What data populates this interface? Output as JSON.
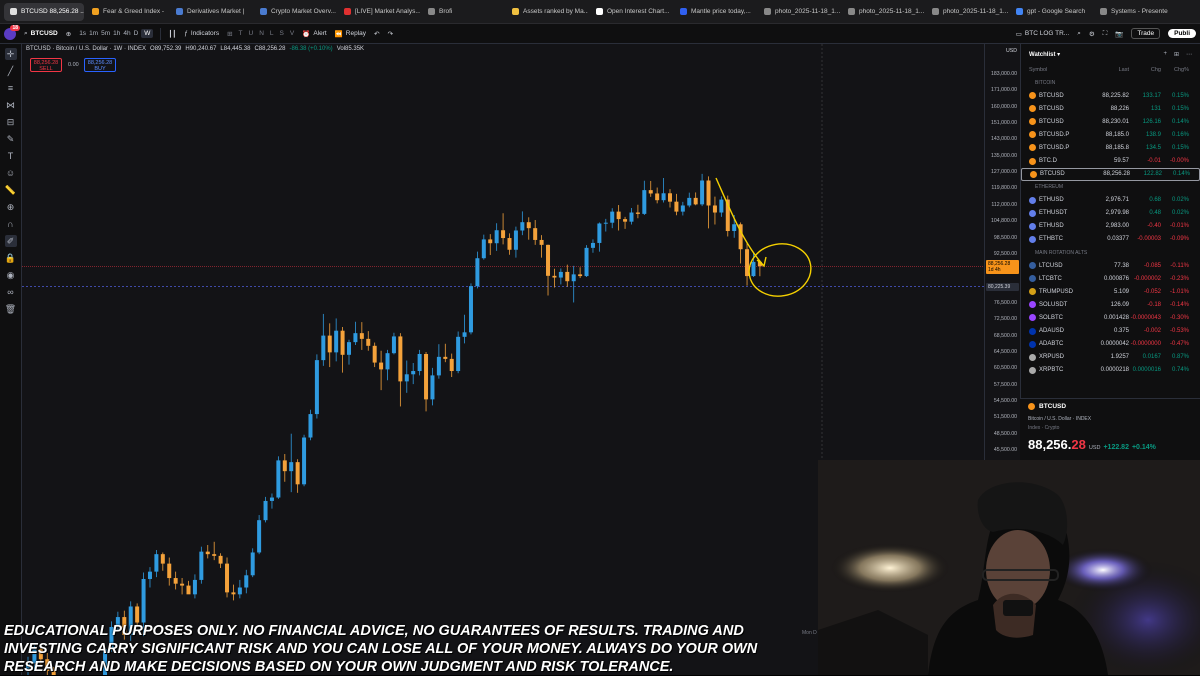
{
  "browser_tabs": [
    {
      "label": "BTCUSD 88,256.28 ...",
      "color": "#e0e0e0",
      "active": true
    },
    {
      "label": "Fear & Greed Index -",
      "color": "#f0a020"
    },
    {
      "label": "Derivatives Market |",
      "color": "#4a7bd0"
    },
    {
      "label": "Crypto Market Overv...",
      "color": "#4a7bd0"
    },
    {
      "label": "[LIVE] Market Analys...",
      "color": "#e03030"
    },
    {
      "label": "Brofi",
      "color": "#888888"
    },
    {
      "label": "Assets ranked by Ma...",
      "color": "#f0c040"
    },
    {
      "label": "Open Interest Chart...",
      "color": "#ffffff"
    },
    {
      "label": "Mantle price today,...",
      "color": "#3060f0"
    },
    {
      "label": "photo_2025-11-18_1...",
      "color": "#888888"
    },
    {
      "label": "photo_2025-11-18_1...",
      "color": "#888888"
    },
    {
      "label": "photo_2025-11-18_1...",
      "color": "#888888"
    },
    {
      "label": "gpt - Google Search",
      "color": "#4285f4"
    },
    {
      "label": "Systems - Presente",
      "color": "#888888"
    }
  ],
  "toolbar": {
    "badge": "18",
    "symbol": "BTCUSD",
    "timeframes": [
      "1s",
      "1m",
      "5m",
      "1h",
      "4h",
      "D",
      "W"
    ],
    "selected_timeframe": "W",
    "indicators": "Indicators",
    "alert": "Alert",
    "replay": "Replay",
    "layout_name": "BTC LOG TR...",
    "trade": "Trade",
    "publish": "Publi"
  },
  "legend": {
    "title": "BTCUSD · Bitcoin / U.S. Dollar · 1W · INDEX",
    "open": "O89,752.39",
    "high": "H90,240.67",
    "low": "L84,445.38",
    "close": "C88,256.28",
    "change": "-86.38 (+0.10%)",
    "volume": "Vol85.35K",
    "sell_price": "88,256.28",
    "sell_label": "SELL",
    "spread": "0.00",
    "buy_price": "88,256.28",
    "buy_label": "BUY"
  },
  "price_axis": {
    "currency": "USD",
    "ticks": [
      "183,000.00",
      "171,000.00",
      "160,000.00",
      "151,000.00",
      "143,000.00",
      "135,000.00",
      "127,000.00",
      "119,800.00",
      "112,000.00",
      "104,800.00",
      "98,500.00",
      "92,500.00",
      "86,900.00",
      "80,225.39",
      "76,500.00",
      "72,500.00",
      "68,500.00",
      "64,500.00",
      "60,500.00",
      "57,500.00",
      "54,500.00",
      "51,500.00",
      "48,500.00",
      "45,500.00"
    ],
    "current_price": "88,256.28",
    "current_time": "1d 4h",
    "line_price": "80,225.39"
  },
  "chart_data": {
    "type": "candlestick",
    "timeframe": "1W",
    "current_price": 88256.28,
    "horizontal_line": 80225.39,
    "candles": [
      [
        19400,
        20300,
        18500,
        19800
      ],
      [
        19800,
        21400,
        19200,
        20900
      ],
      [
        20900,
        21300,
        19700,
        20100
      ],
      [
        20100,
        20600,
        18800,
        19200
      ],
      [
        19200,
        19500,
        17500,
        17800
      ],
      [
        17800,
        18300,
        17200,
        17100
      ],
      [
        17100,
        17400,
        16300,
        16600
      ],
      [
        16600,
        17200,
        16100,
        16800
      ],
      [
        16800,
        17500,
        16500,
        17300
      ],
      [
        17300,
        17800,
        16800,
        17000
      ],
      [
        17000,
        17400,
        16700,
        16600
      ],
      [
        16600,
        17300,
        16400,
        17100
      ],
      [
        17100,
        21300,
        16900,
        20900
      ],
      [
        20900,
        23300,
        20700,
        22800
      ],
      [
        22800,
        24200,
        22500,
        23700
      ],
      [
        23700,
        24300,
        21700,
        22100
      ],
      [
        22100,
        25200,
        21600,
        24700
      ],
      [
        24700,
        25000,
        22700,
        23200
      ],
      [
        23200,
        28200,
        22000,
        27500
      ],
      [
        27500,
        28800,
        26600,
        28300
      ],
      [
        28300,
        30800,
        27700,
        30300
      ],
      [
        30300,
        30500,
        28400,
        29200
      ],
      [
        29200,
        29900,
        26800,
        27600
      ],
      [
        27600,
        28300,
        26400,
        27000
      ],
      [
        27000,
        27600,
        25900,
        26800
      ],
      [
        26800,
        27300,
        26300,
        25900
      ],
      [
        25900,
        28000,
        25500,
        27400
      ],
      [
        27400,
        31200,
        27000,
        30600
      ],
      [
        30600,
        31400,
        29800,
        30300
      ],
      [
        30300,
        31800,
        29600,
        30100
      ],
      [
        30100,
        30400,
        28700,
        29200
      ],
      [
        29200,
        29900,
        25600,
        26100
      ],
      [
        26100,
        26900,
        25300,
        25900
      ],
      [
        25900,
        27400,
        25500,
        26600
      ],
      [
        26600,
        28500,
        26000,
        27900
      ],
      [
        27900,
        31000,
        27700,
        30500
      ],
      [
        30500,
        35300,
        30300,
        34600
      ],
      [
        34600,
        37900,
        34300,
        37300
      ],
      [
        37300,
        38400,
        36200,
        37800
      ],
      [
        37800,
        44400,
        37600,
        43700
      ],
      [
        43700,
        44800,
        40200,
        41900
      ],
      [
        41900,
        48500,
        38600,
        43400
      ],
      [
        43400,
        43900,
        38500,
        39800
      ],
      [
        39800,
        48300,
        39500,
        47800
      ],
      [
        47800,
        52900,
        47300,
        52100
      ],
      [
        52100,
        63900,
        51300,
        62500
      ],
      [
        62500,
        73800,
        61100,
        68500
      ],
      [
        68500,
        71500,
        60800,
        64400
      ],
      [
        64400,
        72700,
        62200,
        69700
      ],
      [
        69700,
        70600,
        59700,
        63800
      ],
      [
        63800,
        67500,
        61400,
        66900
      ],
      [
        66900,
        71900,
        66200,
        69100
      ],
      [
        69100,
        71800,
        65000,
        67700
      ],
      [
        67700,
        69600,
        64800,
        66000
      ],
      [
        66000,
        66800,
        60800,
        61900
      ],
      [
        61900,
        64800,
        56500,
        60300
      ],
      [
        60300,
        65000,
        58300,
        64200
      ],
      [
        64200,
        69200,
        63900,
        68300
      ],
      [
        68300,
        69100,
        53500,
        58100
      ],
      [
        58100,
        62400,
        56000,
        59400
      ],
      [
        59400,
        61800,
        57600,
        60000
      ],
      [
        60000,
        65000,
        59200,
        64000
      ],
      [
        64000,
        64500,
        52600,
        54800
      ],
      [
        54800,
        60600,
        53700,
        59200
      ],
      [
        59200,
        66400,
        58600,
        63300
      ],
      [
        63300,
        66500,
        62000,
        62800
      ],
      [
        62800,
        64100,
        58900,
        60000
      ],
      [
        60000,
        69500,
        59600,
        68200
      ],
      [
        68200,
        73600,
        66600,
        69300
      ],
      [
        69300,
        81500,
        68800,
        80400
      ],
      [
        80400,
        93300,
        79800,
        91000
      ],
      [
        91000,
        99600,
        90500,
        97800
      ],
      [
        97800,
        99800,
        92100,
        96400
      ],
      [
        96400,
        104000,
        93600,
        101300
      ],
      [
        101300,
        108300,
        96000,
        98300
      ],
      [
        98300,
        100100,
        92200,
        94000
      ],
      [
        94000,
        102700,
        91200,
        101200
      ],
      [
        101200,
        109100,
        99400,
        104400
      ],
      [
        104400,
        106500,
        97700,
        102100
      ],
      [
        102100,
        105300,
        95800,
        97600
      ],
      [
        97600,
        99400,
        91200,
        95800
      ],
      [
        95800,
        95900,
        78200,
        84600
      ],
      [
        84600,
        87400,
        80000,
        83900
      ],
      [
        83900,
        87500,
        81100,
        86200
      ],
      [
        86200,
        88800,
        80200,
        82400
      ],
      [
        82400,
        88400,
        76600,
        85200
      ],
      [
        85200,
        87900,
        83700,
        84500
      ],
      [
        84500,
        95700,
        84100,
        94700
      ],
      [
        94700,
        97800,
        92900,
        96500
      ],
      [
        96500,
        104300,
        93300,
        103900
      ],
      [
        103900,
        105800,
        100800,
        104200
      ],
      [
        104200,
        110500,
        102100,
        109000
      ],
      [
        109000,
        111900,
        101200,
        105700
      ],
      [
        105700,
        106700,
        101800,
        104600
      ],
      [
        104600,
        110600,
        103500,
        108600
      ],
      [
        108600,
        112000,
        106100,
        108000
      ],
      [
        108000,
        123200,
        107500,
        119000
      ],
      [
        119000,
        123100,
        115800,
        117400
      ],
      [
        117400,
        120200,
        112700,
        114200
      ],
      [
        114200,
        124400,
        113100,
        117500
      ],
      [
        117500,
        119500,
        110800,
        113500
      ],
      [
        113500,
        117200,
        107400,
        109000
      ],
      [
        109000,
        113400,
        107300,
        111700
      ],
      [
        111700,
        117800,
        110900,
        115300
      ],
      [
        115300,
        117900,
        111800,
        112200
      ],
      [
        112200,
        126200,
        111400,
        123300
      ],
      [
        123300,
        125100,
        102000,
        111700
      ],
      [
        111700,
        115900,
        103500,
        108600
      ],
      [
        108600,
        116000,
        106700,
        114500
      ],
      [
        114500,
        116400,
        98900,
        101000
      ],
      [
        101000,
        107500,
        98400,
        103600
      ],
      [
        103600,
        104300,
        89200,
        94200
      ],
      [
        94200,
        96600,
        80600,
        84500
      ],
      [
        84500,
        93100,
        84100,
        89752
      ],
      [
        89752,
        90241,
        84445,
        88256
      ]
    ]
  },
  "watchlist": {
    "title": "Watchlist",
    "columns": [
      "Symbol",
      "Last",
      "Chg",
      "Chg%"
    ],
    "sections": [
      {
        "name": "BITCOIN",
        "rows": [
          {
            "sym": "BTCUSD",
            "last": "88,225.82",
            "chg": "133.17",
            "pct": "0.15%",
            "dir": "up",
            "color": "#f7931a"
          },
          {
            "sym": "BTCUSD",
            "last": "88,226",
            "chg": "131",
            "pct": "0.15%",
            "dir": "up",
            "color": "#f7931a"
          },
          {
            "sym": "BTCUSD",
            "last": "88,230.01",
            "chg": "126.16",
            "pct": "0.14%",
            "dir": "up",
            "color": "#f7931a"
          },
          {
            "sym": "BTCUSD.P",
            "last": "88,185.0",
            "chg": "138.9",
            "pct": "0.16%",
            "dir": "up",
            "color": "#f7931a"
          },
          {
            "sym": "BTCUSD.P",
            "last": "88,185.8",
            "chg": "134.5",
            "pct": "0.15%",
            "dir": "up",
            "color": "#f7931a"
          },
          {
            "sym": "BTC.D",
            "last": "59.57",
            "chg": "-0.01",
            "pct": "-0.00%",
            "dir": "dn",
            "color": "#f7931a"
          },
          {
            "sym": "BTCUSD",
            "last": "88,256.28",
            "chg": "122.82",
            "pct": "0.14%",
            "dir": "up",
            "color": "#f7931a",
            "highlight": true
          }
        ]
      },
      {
        "name": "ETHEREUM",
        "rows": [
          {
            "sym": "ETHUSD",
            "last": "2,976.71",
            "chg": "0.68",
            "pct": "0.02%",
            "dir": "up",
            "color": "#627eea"
          },
          {
            "sym": "ETHUSDT",
            "last": "2,979.98",
            "chg": "0.48",
            "pct": "0.02%",
            "dir": "up",
            "color": "#627eea"
          },
          {
            "sym": "ETHUSD",
            "last": "2,983.00",
            "chg": "-0.40",
            "pct": "-0.01%",
            "dir": "dn",
            "color": "#627eea"
          },
          {
            "sym": "ETHBTC",
            "last": "0.03377",
            "chg": "-0.00003",
            "pct": "-0.09%",
            "dir": "dn",
            "color": "#627eea"
          }
        ]
      },
      {
        "name": "MAIN ROTATION ALTS",
        "rows": [
          {
            "sym": "LTCUSD",
            "last": "77.38",
            "chg": "-0.085",
            "pct": "-0.11%",
            "dir": "dn",
            "color": "#345d9d"
          },
          {
            "sym": "LTCBTC",
            "last": "0.000876",
            "chg": "-0.000002",
            "pct": "-0.23%",
            "dir": "dn",
            "color": "#345d9d"
          },
          {
            "sym": "TRUMPUSD",
            "last": "5.109",
            "chg": "-0.052",
            "pct": "-1.01%",
            "dir": "dn",
            "color": "#d4a017"
          },
          {
            "sym": "SOLUSDT",
            "last": "126.09",
            "chg": "-0.18",
            "pct": "-0.14%",
            "dir": "dn",
            "color": "#9945ff"
          },
          {
            "sym": "SOLBTC",
            "last": "0.001428",
            "chg": "-0.0000043",
            "pct": "-0.30%",
            "dir": "dn",
            "color": "#9945ff"
          },
          {
            "sym": "ADAUSD",
            "last": "0.375",
            "chg": "-0.002",
            "pct": "-0.53%",
            "dir": "dn",
            "color": "#0033ad"
          },
          {
            "sym": "ADABTC",
            "last": "0.0000042",
            "chg": "-0.0000000",
            "pct": "-0.47%",
            "dir": "dn",
            "color": "#0033ad"
          },
          {
            "sym": "XRPUSD",
            "last": "1.9257",
            "chg": "0.0167",
            "pct": "0.87%",
            "dir": "up",
            "color": "#aaaaaa"
          },
          {
            "sym": "XRPBTC",
            "last": "0.0000218",
            "chg": "0.0000016",
            "pct": "0.74%",
            "dir": "up",
            "color": "#aaaaaa"
          }
        ]
      }
    ]
  },
  "detail": {
    "symbol": "BTCUSD",
    "name": "Bitcoin / U.S. Dollar",
    "exchange": "INDEX",
    "category": "Index · Crypto",
    "price_main": "88,256.",
    "price_frac": "28",
    "currency": "USD",
    "change": "+122.82",
    "change_pct": "+0.14%"
  },
  "disclaimer": "Educational purposes only. No financial advice, no guarantees of results. Trading and investing carry significant risk and you can lose all of your money. Always do your own research and make decisions based on your own judgment and risk tolerance.",
  "bottom_axis_label": "17",
  "date_label": "Mon D"
}
